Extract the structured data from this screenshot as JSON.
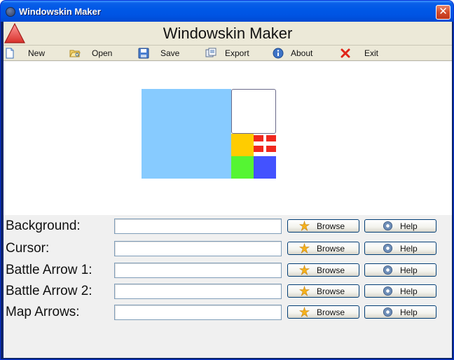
{
  "window": {
    "title": "Windowskin Maker",
    "close_glyph": "✕"
  },
  "header": {
    "title": "Windowskin Maker",
    "logo_icon": "red-triangle-logo-icon"
  },
  "toolbar": {
    "items": [
      {
        "label": "New",
        "icon": "new-document-icon"
      },
      {
        "label": "Open",
        "icon": "open-folder-icon"
      },
      {
        "label": "Save",
        "icon": "floppy-disk-icon"
      },
      {
        "label": "Export",
        "icon": "export-icon"
      },
      {
        "label": "About",
        "icon": "info-icon"
      },
      {
        "label": "Exit",
        "icon": "red-x-icon"
      }
    ]
  },
  "preview": {
    "tiles": {
      "background": "#87cbff",
      "frame": "#ffffff",
      "cursor": "#ffcc00",
      "arrows": "#f0281e",
      "green": "#55f533",
      "blue": "#4352ff"
    }
  },
  "form": {
    "browse_label": "Browse",
    "help_label": "Help",
    "rows": [
      {
        "label": "Background:",
        "value": ""
      },
      {
        "label": "Cursor:",
        "value": ""
      },
      {
        "label": "Battle Arrow 1:",
        "value": ""
      },
      {
        "label": "Battle Arrow 2:",
        "value": ""
      },
      {
        "label": "Map Arrows:",
        "value": ""
      }
    ]
  }
}
